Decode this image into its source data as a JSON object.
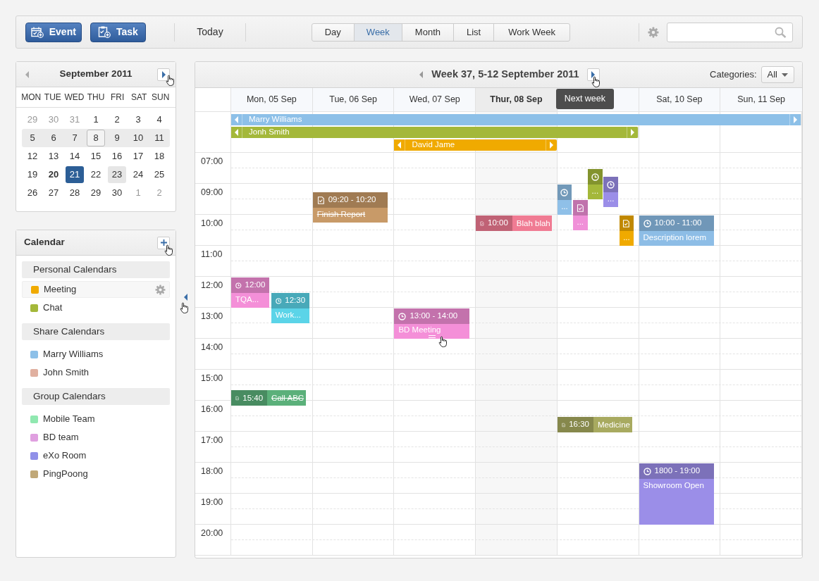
{
  "toolbar": {
    "buttons": [
      {
        "label": "Event"
      },
      {
        "label": "Task"
      }
    ],
    "today": "Today",
    "views": [
      {
        "label": "Day",
        "selected": false
      },
      {
        "label": "Week",
        "selected": true
      },
      {
        "label": "Month",
        "selected": false
      },
      {
        "label": "List",
        "selected": false
      },
      {
        "label": "Work Week",
        "selected": false
      }
    ]
  },
  "mini_calendar": {
    "title": "September 2011",
    "weekdays": [
      "MON",
      "TUE",
      "WED",
      "THU",
      "FRI",
      "SAT",
      "SUN"
    ],
    "weeks": [
      {
        "highlighted": false,
        "days": [
          {
            "text": "29",
            "kind": "muted"
          },
          {
            "text": "30",
            "kind": "muted"
          },
          {
            "text": "31",
            "kind": "muted"
          },
          {
            "text": "1",
            "kind": "normal"
          },
          {
            "text": "2",
            "kind": "normal"
          },
          {
            "text": "3",
            "kind": "normal"
          },
          {
            "text": "4",
            "kind": "normal"
          }
        ]
      },
      {
        "highlighted": true,
        "days": [
          {
            "text": "5",
            "kind": "normal"
          },
          {
            "text": "6",
            "kind": "normal"
          },
          {
            "text": "7",
            "kind": "normal"
          },
          {
            "text": "8",
            "kind": "outlined"
          },
          {
            "text": "9",
            "kind": "normal"
          },
          {
            "text": "10",
            "kind": "normal"
          },
          {
            "text": "11",
            "kind": "normal"
          }
        ]
      },
      {
        "highlighted": false,
        "days": [
          {
            "text": "12",
            "kind": "normal"
          },
          {
            "text": "13",
            "kind": "normal"
          },
          {
            "text": "14",
            "kind": "normal"
          },
          {
            "text": "15",
            "kind": "normal"
          },
          {
            "text": "16",
            "kind": "normal"
          },
          {
            "text": "17",
            "kind": "normal"
          },
          {
            "text": "18",
            "kind": "normal"
          }
        ]
      },
      {
        "highlighted": false,
        "days": [
          {
            "text": "19",
            "kind": "normal"
          },
          {
            "text": "20",
            "kind": "bold"
          },
          {
            "text": "21",
            "kind": "selected"
          },
          {
            "text": "22",
            "kind": "normal"
          },
          {
            "text": "23",
            "kind": "hovered"
          },
          {
            "text": "24",
            "kind": "normal"
          },
          {
            "text": "25",
            "kind": "normal"
          }
        ]
      },
      {
        "highlighted": false,
        "days": [
          {
            "text": "26",
            "kind": "normal"
          },
          {
            "text": "27",
            "kind": "normal"
          },
          {
            "text": "28",
            "kind": "normal"
          },
          {
            "text": "29",
            "kind": "normal"
          },
          {
            "text": "30",
            "kind": "normal"
          },
          {
            "text": "1",
            "kind": "muted"
          },
          {
            "text": "2",
            "kind": "muted"
          }
        ]
      }
    ]
  },
  "calendar_list": {
    "title": "Calendar",
    "groups": [
      {
        "title": "Personal Calendars",
        "items": [
          {
            "name": "Meeting",
            "color": "#f0aa00",
            "hovered": true
          },
          {
            "name": "Chat",
            "color": "#a4b83a",
            "hovered": false
          }
        ]
      },
      {
        "title": "Share Calendars",
        "items": [
          {
            "name": "Marry Williams",
            "color": "#8dc0e8",
            "hovered": false
          },
          {
            "name": "John Smith",
            "color": "#e0b0a0",
            "hovered": false
          }
        ]
      },
      {
        "title": "Group Calendars",
        "items": [
          {
            "name": "Mobile Team",
            "color": "#90e8b0",
            "hovered": false
          },
          {
            "name": "BD team",
            "color": "#e0a0e0",
            "hovered": false
          },
          {
            "name": "eXo Room",
            "color": "#9090e8",
            "hovered": false
          },
          {
            "name": "PingPoong",
            "color": "#c0a878",
            "hovered": false
          }
        ]
      }
    ]
  },
  "week_view": {
    "title": "Week 37, 5-12 September 2011",
    "categories_label": "Categories:",
    "category": "All",
    "tooltip": "Next week",
    "days": [
      {
        "label": "Mon, 05 Sep",
        "today": false
      },
      {
        "label": "Tue, 06 Sep",
        "today": false
      },
      {
        "label": "Wed, 07 Sep",
        "today": false
      },
      {
        "label": "Thur, 08 Sep",
        "today": true
      },
      {
        "today": false
      },
      {
        "label": "Sat, 10 Sep",
        "today": false
      },
      {
        "label": "Sun, 11 Sep",
        "today": false
      }
    ],
    "time_labels": [
      "07:00",
      "09:00",
      "10:00",
      "11:00",
      "12:00",
      "13:00",
      "14:00",
      "15:00",
      "16:00",
      "17:00",
      "18:00",
      "19:00",
      "20:00"
    ],
    "all_day_events": [
      {
        "title": "Marry Williams",
        "color": "#8dc0e8",
        "continues_before": true,
        "continues_after": true
      },
      {
        "title": "Jonh Smith",
        "color": "#a4b83a",
        "continues_before": true,
        "continues_after": true
      },
      {
        "title": "David Jame",
        "color": "#f0aa00",
        "continues_before": true,
        "continues_after": true
      }
    ],
    "events": [
      {
        "kind": "event_block",
        "time": "12:00",
        "title": "TQA...",
        "color": "#f48fd8",
        "done": false,
        "hovered": false
      },
      {
        "kind": "event_block",
        "time": "12:30",
        "title": "Work...",
        "color": "#5bd4e8",
        "done": false,
        "hovered": false
      },
      {
        "kind": "task_block",
        "time": "09:20 - 10:20",
        "title": "Finish Report",
        "color": "#c89a68",
        "done": true,
        "hovered": false
      },
      {
        "kind": "task_inline",
        "time": "10:00",
        "title": "Blah blah",
        "color": "#f07b93",
        "done": false,
        "hovered": false
      },
      {
        "kind": "event_compact",
        "title": "...",
        "color": "#8fc0e8",
        "done": false,
        "hovered": false
      },
      {
        "kind": "task_compact",
        "title": "...",
        "color": "#f090d8",
        "done": false,
        "hovered": false
      },
      {
        "kind": "event_compact",
        "title": "...",
        "color": "#a4b83a",
        "done": false,
        "hovered": false
      },
      {
        "kind": "event_compact",
        "title": "...",
        "color": "#9b8ee8",
        "done": false,
        "hovered": false
      },
      {
        "kind": "task_compact",
        "title": "...",
        "color": "#f0aa00",
        "done": false,
        "hovered": false
      },
      {
        "kind": "event_block",
        "time": "10:00 - 11:00",
        "title": "Description lorem",
        "color": "#8dbde6",
        "done": false,
        "hovered": false
      },
      {
        "kind": "event_block",
        "time": "13:00 - 14:00",
        "title": "BD Meeting",
        "color": "#f48fd8",
        "done": false,
        "hovered": true
      },
      {
        "kind": "task_inline",
        "time": "15:40",
        "title": "Call ABC",
        "color": "#5bb07a",
        "done": true,
        "hovered": false
      },
      {
        "kind": "task_inline",
        "time": "16:30",
        "title": "Medicine",
        "color": "#a8aa60",
        "done": false,
        "hovered": false
      },
      {
        "kind": "event_block",
        "time": "1800 - 19:00",
        "title": "Showroom Open",
        "color": "#9b8ee8",
        "done": false,
        "hovered": false
      }
    ]
  }
}
